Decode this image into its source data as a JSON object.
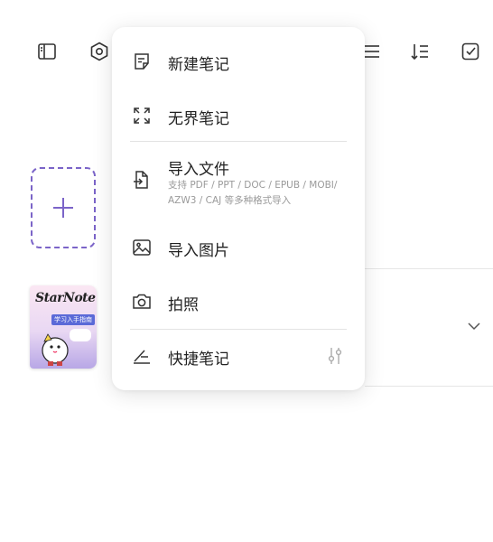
{
  "toolbar": {
    "left_icons": [
      "sidebar-icon",
      "settings-hex-icon"
    ],
    "right_icons": [
      "list-icon",
      "sort-icon",
      "checkbox-icon"
    ]
  },
  "menu": {
    "items": [
      {
        "label": "新建笔记",
        "icon": "new-note-icon"
      },
      {
        "label": "无界笔记",
        "icon": "expand-icon"
      },
      {
        "label": "导入文件",
        "icon": "import-file-icon",
        "description": "支持 PDF / PPT / DOC / EPUB / MOBI/ AZW3 / CAJ 等多种格式导入"
      },
      {
        "label": "导入图片",
        "icon": "image-icon"
      },
      {
        "label": "拍照",
        "icon": "camera-icon"
      },
      {
        "label": "快捷笔记",
        "icon": "quick-note-icon",
        "trailing_icon": "adjust-icon"
      }
    ]
  },
  "notebook": {
    "cover_title": "StarNote",
    "cover_subtitle": "学习入手指南"
  },
  "colors": {
    "accent": "#7b64c8"
  }
}
